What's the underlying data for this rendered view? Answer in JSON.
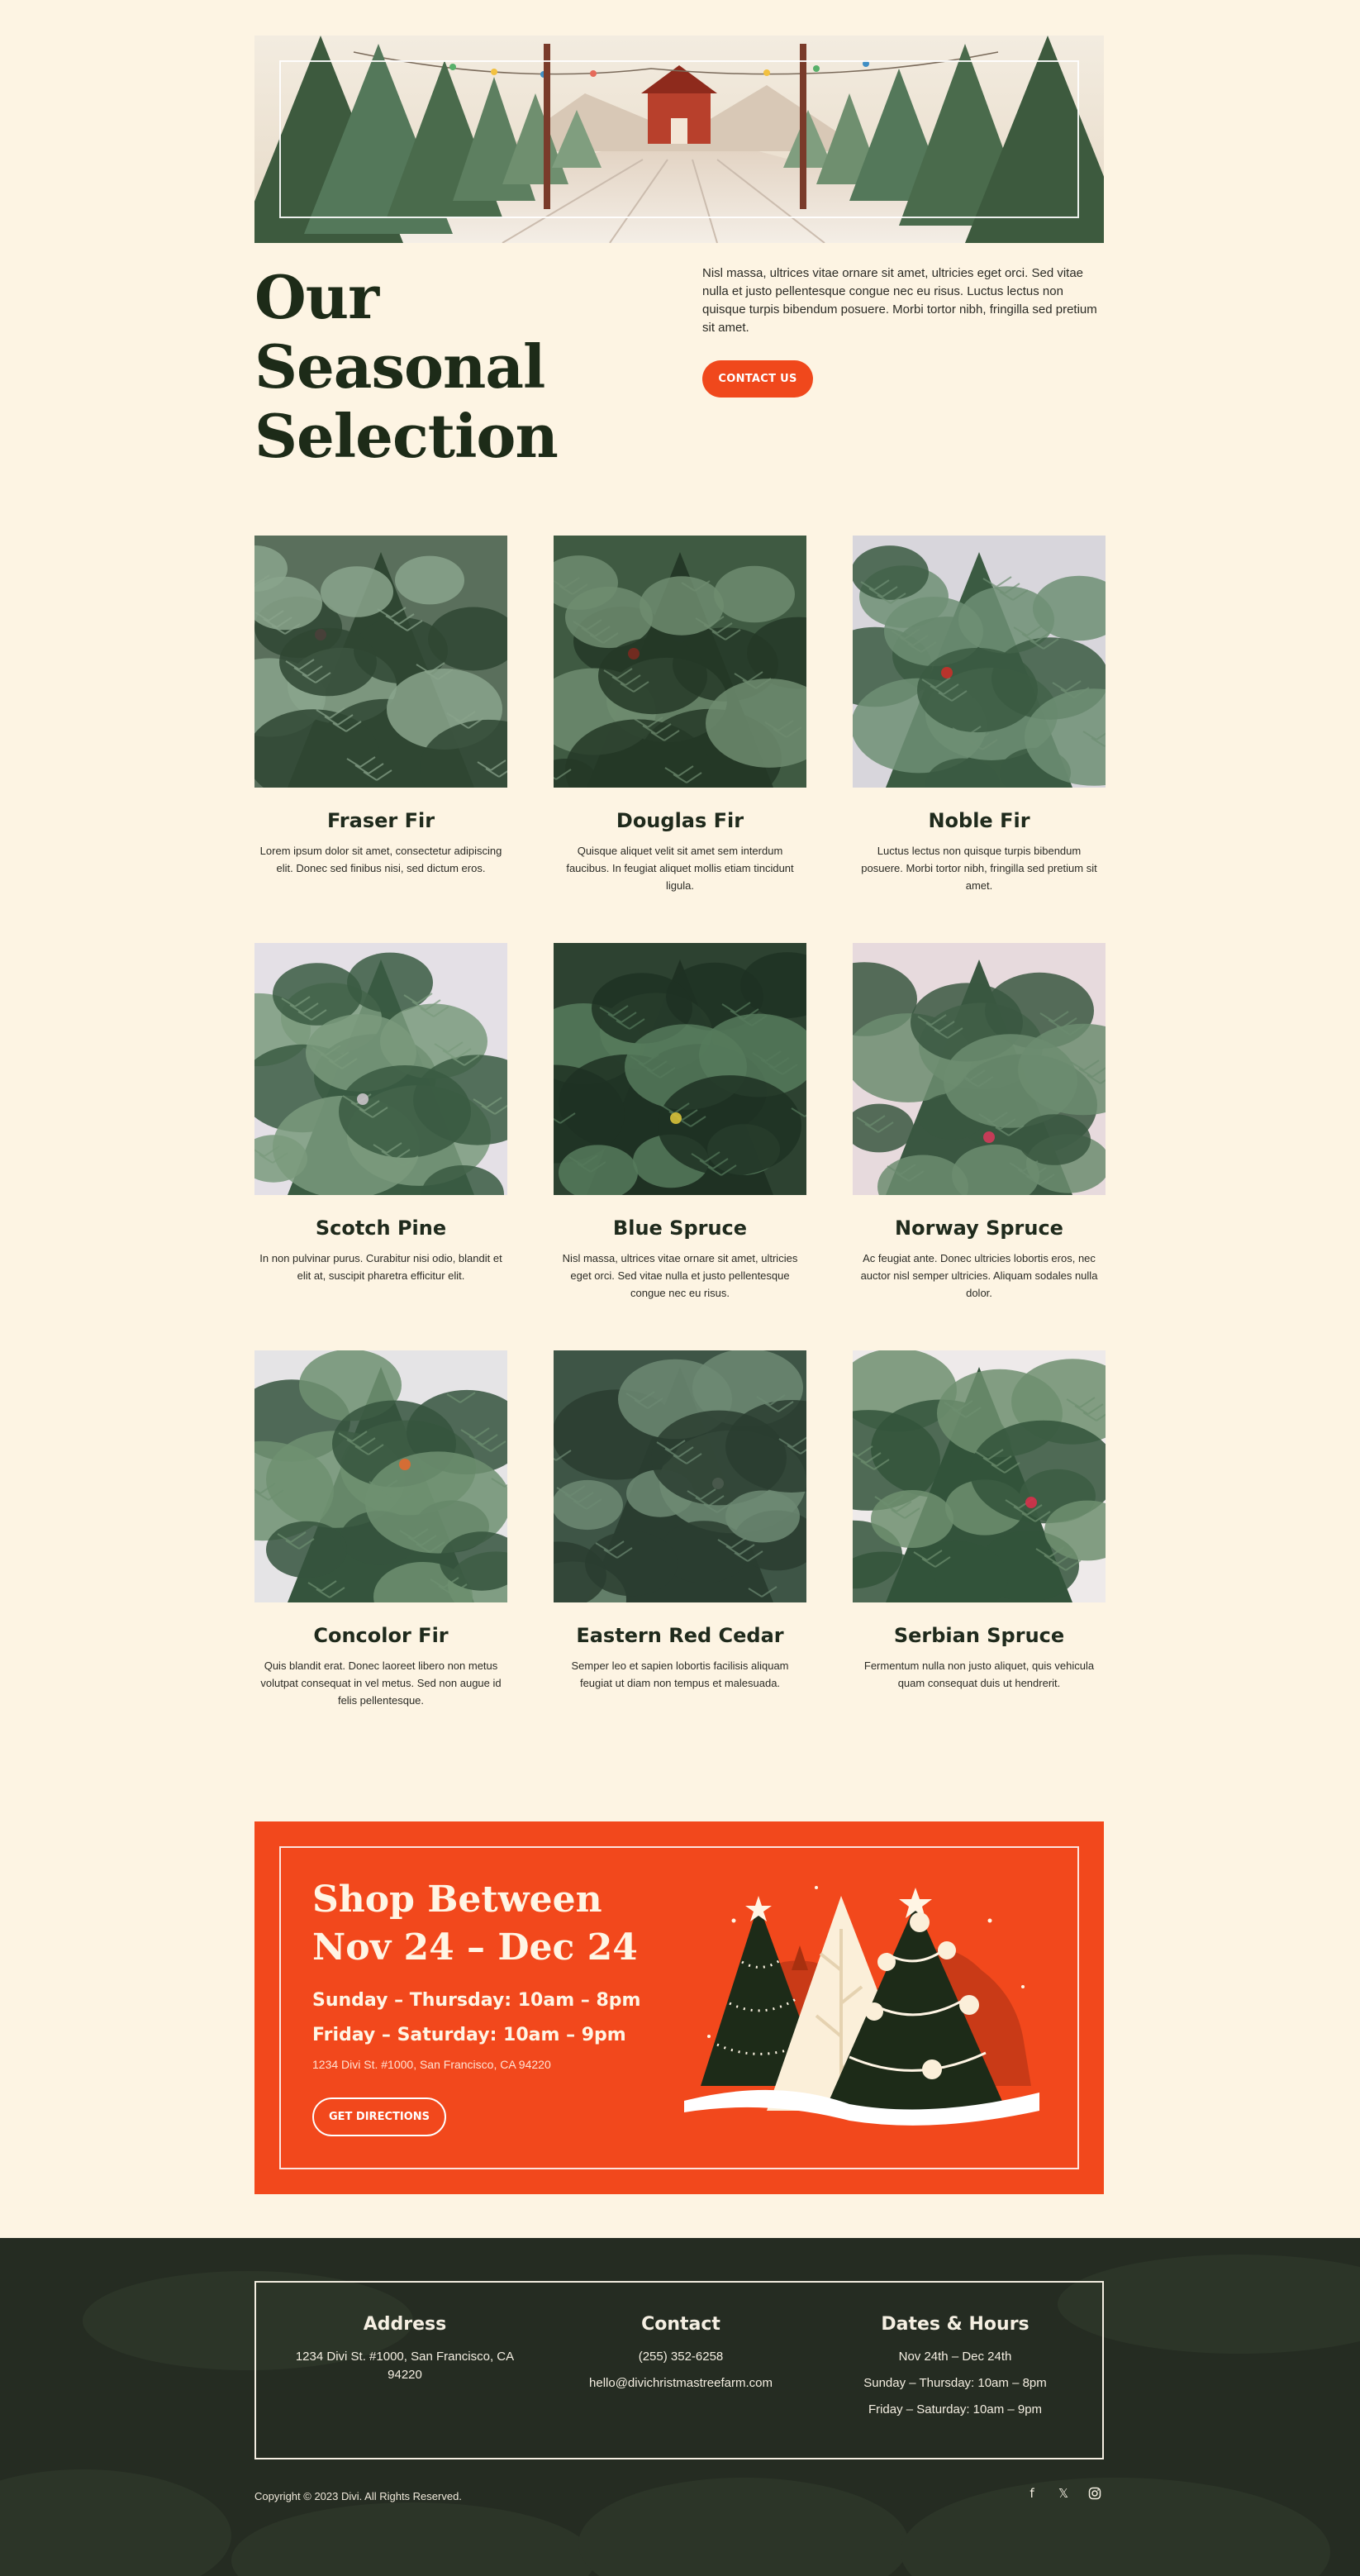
{
  "hero": {
    "title": "Our Seasonal Selection",
    "text": "Nisl massa, ultrices vitae ornare sit amet, ultricies eget orci. Sed vitae nulla et justo pellentesque congue nec eu risus. Luctus lectus non quisque turpis bibendum posuere. Morbi tortor nibh, fringilla sed pretium sit amet.",
    "button": "CONTACT US"
  },
  "trees": [
    {
      "name": "Fraser Fir",
      "desc": "Lorem ipsum dolor sit amet, consectetur adipiscing elit. Donec sed finibus nisi, sed dictum eros."
    },
    {
      "name": "Douglas Fir",
      "desc": "Quisque aliquet velit sit amet sem interdum faucibus. In feugiat aliquet mollis etiam tincidunt ligula."
    },
    {
      "name": "Noble Fir",
      "desc": "Luctus lectus non quisque turpis bibendum posuere. Morbi tortor nibh, fringilla sed pretium sit amet."
    },
    {
      "name": "Scotch Pine",
      "desc": "In non pulvinar purus. Curabitur nisi odio, blandit et elit at, suscipit pharetra efficitur elit."
    },
    {
      "name": "Blue Spruce",
      "desc": "Nisl massa, ultrices vitae ornare sit amet, ultricies eget orci. Sed vitae nulla et justo pellentesque congue nec eu risus."
    },
    {
      "name": "Norway Spruce",
      "desc": "Ac feugiat ante. Donec ultricies lobortis eros, nec auctor nisl semper ultricies. Aliquam sodales nulla dolor."
    },
    {
      "name": "Concolor Fir",
      "desc": "Quis blandit erat. Donec laoreet libero non metus volutpat consequat in vel metus. Sed non augue id felis pellentesque."
    },
    {
      "name": "Eastern Red Cedar",
      "desc": "Semper leo et sapien lobortis facilisis aliquam feugiat ut diam non tempus et malesuada."
    },
    {
      "name": "Serbian Spruce",
      "desc": "Fermentum nulla non justo aliquet, quis vehicula quam consequat duis ut hendrerit."
    }
  ],
  "shop": {
    "title": "Shop Between Nov 24 – Dec 24",
    "hours_weekday": "Sunday – Thursday: 10am – 8pm",
    "hours_weekend": "Friday – Saturday: 10am – 9pm",
    "address": "1234 Divi St. #1000, San Francisco, CA 94220",
    "button": "GET DIRECTIONS"
  },
  "footer": {
    "address_title": "Address",
    "address": "1234 Divi St. #1000, San Francisco, CA 94220",
    "contact_title": "Contact",
    "phone": "(255) 352-6258",
    "email": "hello@divichristmastreefarm.com",
    "dates_title": "Dates & Hours",
    "dates": "Nov 24th – Dec 24th",
    "hours_weekday": "Sunday – Thursday: 10am – 8pm",
    "hours_weekend": "Friday – Saturday: 10am – 9pm",
    "copyright": "Copyright © 2023 Divi. All Rights Reserved.",
    "socials": [
      "facebook-icon",
      "x-icon",
      "instagram-icon"
    ]
  },
  "colors": {
    "background": "#fdf4e3",
    "accent": "#f0481c",
    "dark_green": "#1d2b18",
    "footer": "#232a20"
  }
}
